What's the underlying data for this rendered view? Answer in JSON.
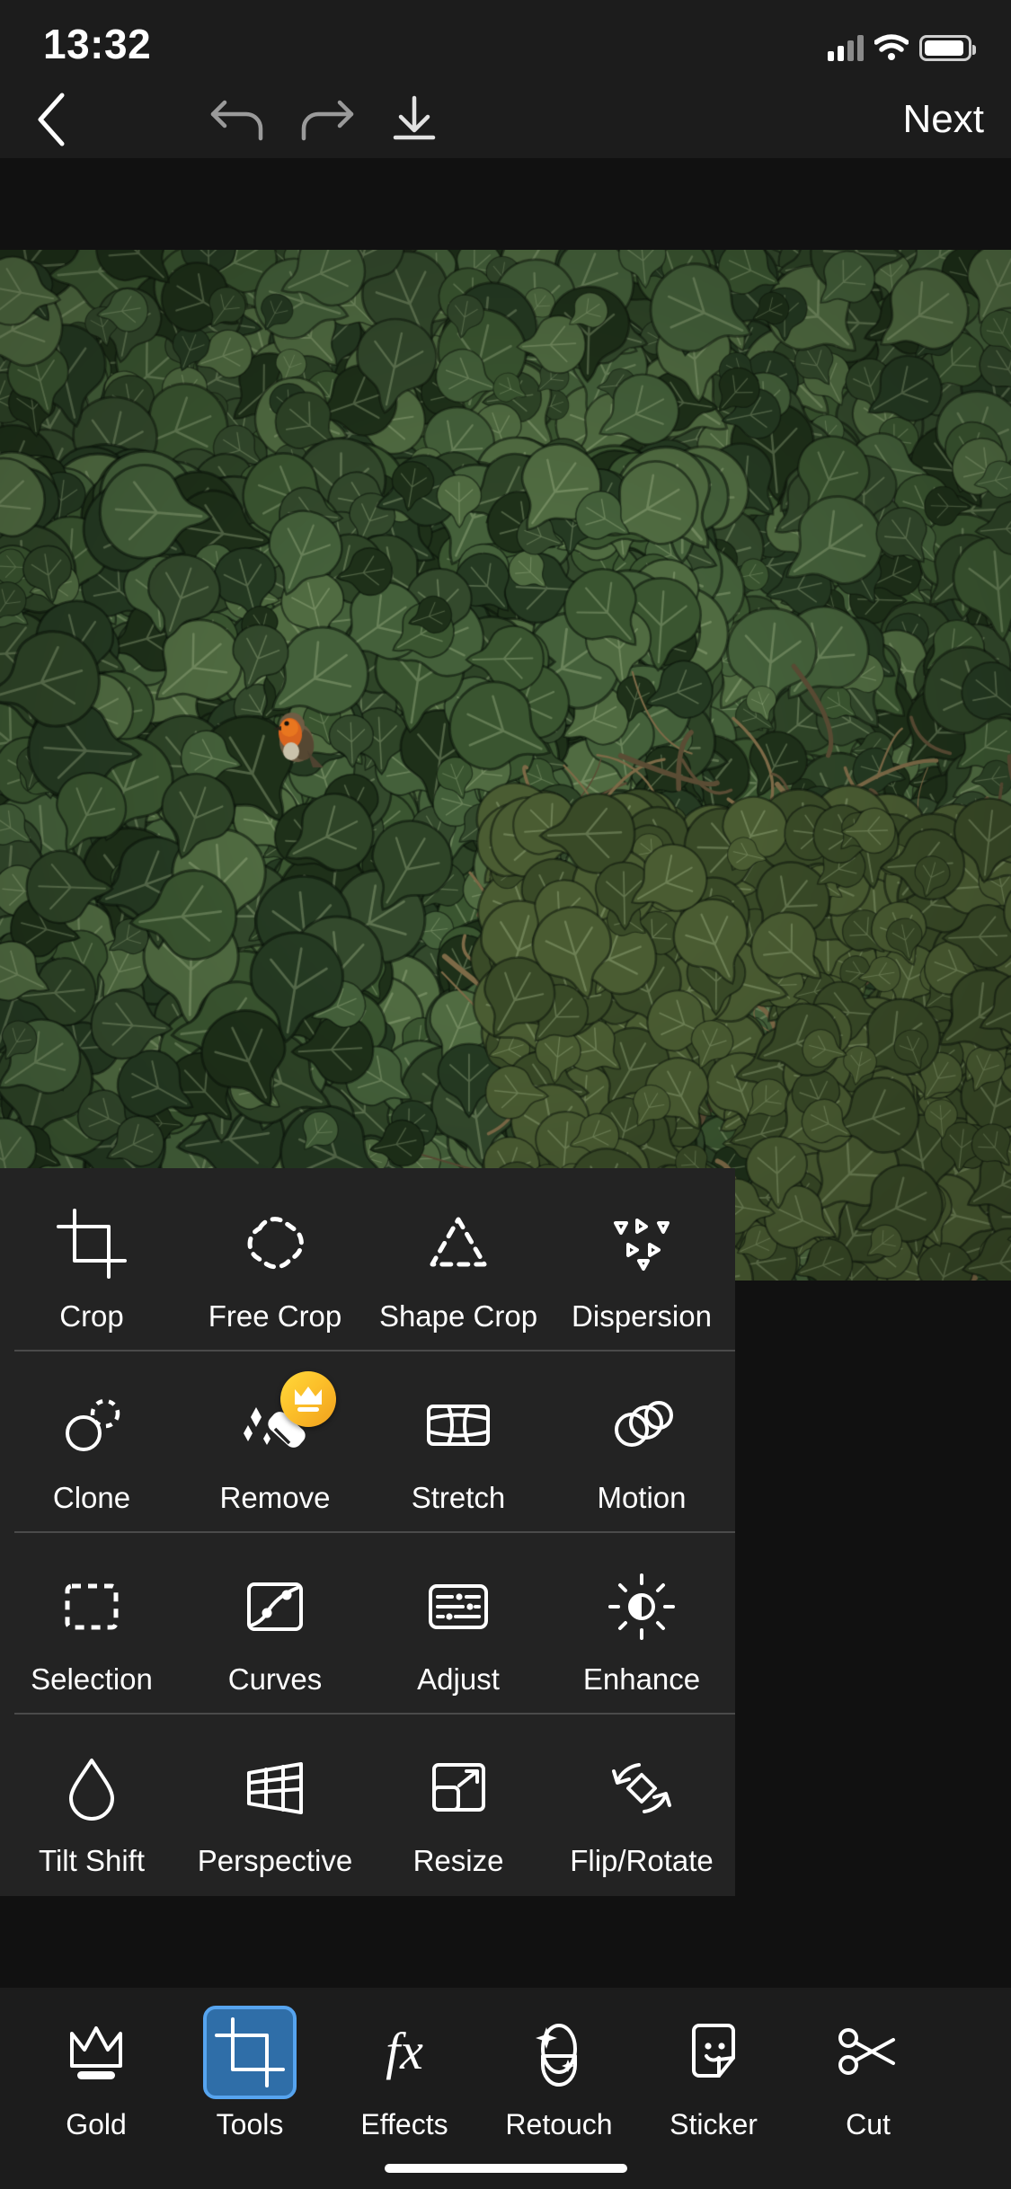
{
  "status_bar": {
    "time": "13:32",
    "icons": [
      "cellular-signal-icon",
      "wifi-icon",
      "battery-icon"
    ]
  },
  "toolbar": {
    "back_icon": "chevron-left-icon",
    "undo_icon": "undo-arrow-icon",
    "redo_icon": "redo-arrow-icon",
    "save_icon": "download-icon",
    "next_label": "Next"
  },
  "tools_panel": {
    "rows": [
      [
        {
          "label": "Crop",
          "icon": "crop-icon",
          "pro": false
        },
        {
          "label": "Free Crop",
          "icon": "free-crop-icon",
          "pro": false
        },
        {
          "label": "Shape Crop",
          "icon": "shape-crop-icon",
          "pro": false
        },
        {
          "label": "Dispersion",
          "icon": "dispersion-icon",
          "pro": false
        }
      ],
      [
        {
          "label": "Clone",
          "icon": "clone-icon",
          "pro": false
        },
        {
          "label": "Remove",
          "icon": "remove-eraser-icon",
          "pro": true
        },
        {
          "label": "Stretch",
          "icon": "stretch-icon",
          "pro": false
        },
        {
          "label": "Motion",
          "icon": "motion-icon",
          "pro": false
        }
      ],
      [
        {
          "label": "Selection",
          "icon": "selection-icon",
          "pro": false
        },
        {
          "label": "Curves",
          "icon": "curves-icon",
          "pro": false
        },
        {
          "label": "Adjust",
          "icon": "adjust-icon",
          "pro": false
        },
        {
          "label": "Enhance",
          "icon": "enhance-icon",
          "pro": false
        }
      ],
      [
        {
          "label": "Tilt Shift",
          "icon": "tilt-shift-icon",
          "pro": false
        },
        {
          "label": "Perspective",
          "icon": "perspective-icon",
          "pro": false
        },
        {
          "label": "Resize",
          "icon": "resize-icon",
          "pro": false
        },
        {
          "label": "Flip/Rotate",
          "icon": "flip-rotate-icon",
          "pro": false
        }
      ]
    ],
    "pro_badge_icon": "crown-icon"
  },
  "tab_bar": {
    "active": "Tools",
    "items": [
      {
        "label": "Gold",
        "icon": "crown-icon",
        "active": false
      },
      {
        "label": "Tools",
        "icon": "crop-icon",
        "active": true
      },
      {
        "label": "Effects",
        "icon": "fx-icon",
        "active": false
      },
      {
        "label": "Retouch",
        "icon": "face-retouch-icon",
        "active": false
      },
      {
        "label": "Sticker",
        "icon": "sticker-face-icon",
        "active": false
      },
      {
        "label": "Cut",
        "icon": "cutout-scissors-icon",
        "active": false
      }
    ]
  },
  "colors": {
    "panel_bg": "#232323",
    "app_bg": "#1c1c1c",
    "letterbox": "#111111",
    "accent_blue": "#2f6ea8",
    "accent_blue_border": "#56a4ef",
    "pro_gold": "#fcc02a",
    "divider": "#4a4a4a",
    "text": "#ffffff",
    "icon_dim": "#9a9a9a"
  }
}
